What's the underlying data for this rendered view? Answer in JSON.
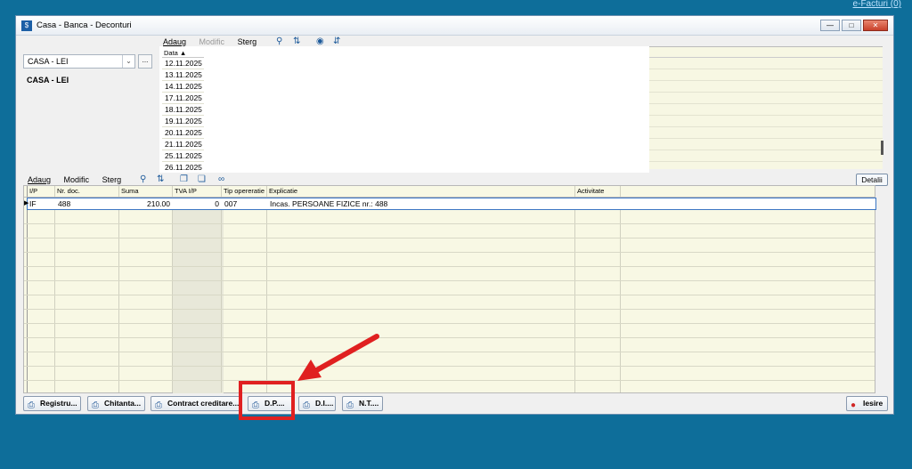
{
  "efacturi": "e-Facturi (0)",
  "window": {
    "title": "Casa - Banca - Deconturi",
    "minimize": "—",
    "maximize": "□",
    "close": "✕"
  },
  "top_toolbar": {
    "add": "Adaug",
    "modify": "Modific",
    "delete": "Sterg"
  },
  "account": {
    "selected": "CASA - LEI",
    "label": "CASA - LEI",
    "ellipsis": "..."
  },
  "dates": {
    "header": "Data ▲",
    "items": [
      "12.11.2025",
      "13.11.2025",
      "14.11.2025",
      "17.11.2025",
      "18.11.2025",
      "19.11.2025",
      "20.11.2025",
      "21.11.2025",
      "25.11.2025",
      "26.11.2025"
    ]
  },
  "lower_toolbar": {
    "add": "Adaug",
    "modify": "Modific",
    "delete": "Sterg",
    "details": "Detalii"
  },
  "grid": {
    "columns": [
      "I/P",
      "Nr. doc.",
      "Suma",
      "TVA I/P",
      "Tip opereratie",
      "Explicatie",
      "Activitate"
    ],
    "rows": [
      {
        "ip": "IF",
        "nr_doc": "488",
        "suma": "210.00",
        "tva": "0",
        "tip": "007",
        "explicatie": "Incas. PERSOANE FIZICE nr.: 488",
        "activitate": ""
      }
    ]
  },
  "bottom_buttons": {
    "registru": "Registru...",
    "chitanta": "Chitanta...",
    "contract": "Contract creditare...",
    "dp": "D.P....",
    "di": "D.I....",
    "nt": "N.T....",
    "iesire": "Iesire"
  },
  "colors": {
    "background": "#0e6e9a",
    "highlight": "#e02020"
  }
}
